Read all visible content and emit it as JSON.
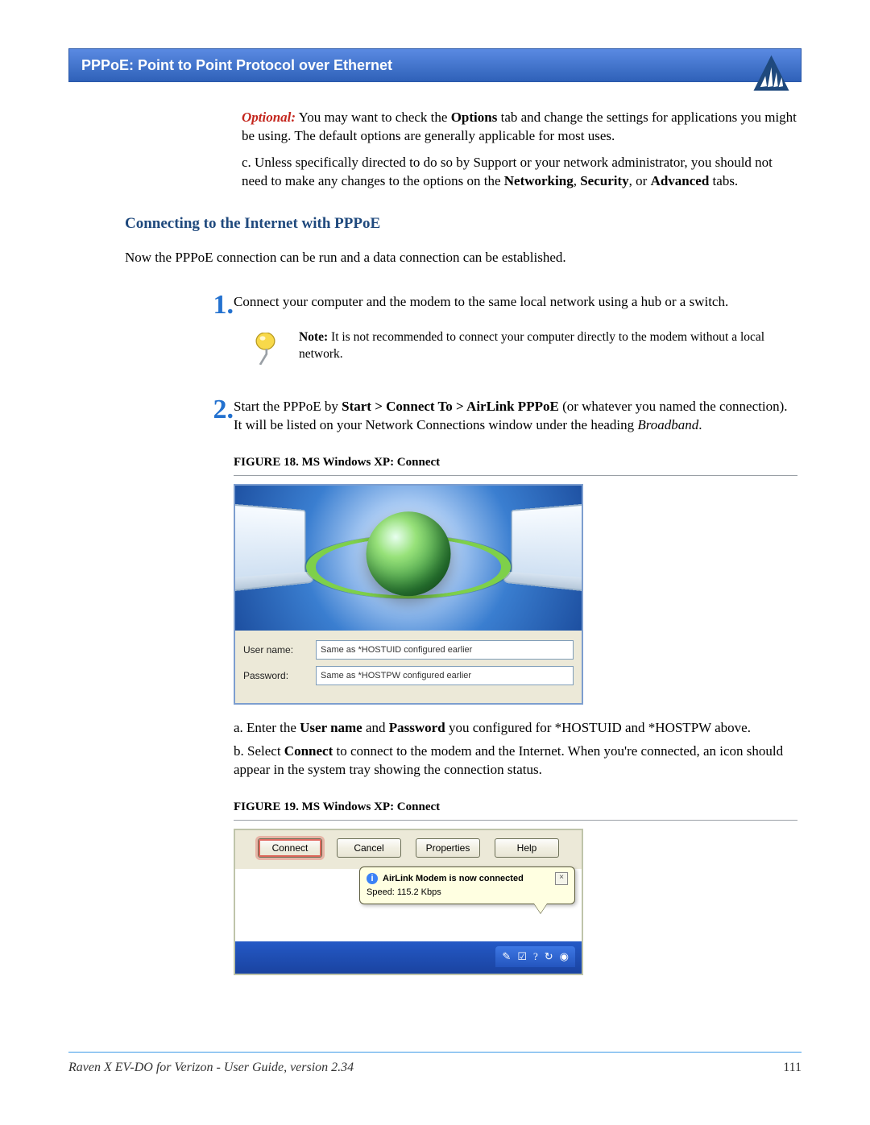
{
  "header": {
    "title": "PPPoE: Point to Point Protocol over Ethernet"
  },
  "intro": {
    "optional_label": "Optional:",
    "optional_text": " You may want to check the ",
    "options_bold": "Options",
    "optional_text2": " tab and change the settings for applications you might be using.  The default options are generally applicable for most uses.",
    "c_pre": "c. Unless specifically directed to do so by Support or your network administrator, you should not need to make any changes to the options on the ",
    "nw": "Networking",
    "comma": ", ",
    "sec": "Security",
    "or": ", or ",
    "adv": "Advanced",
    "c_post": " tabs."
  },
  "section_heading": "Connecting to the Internet with PPPoE",
  "section_intro": "Now the PPPoE connection can be run and a data connection can be established.",
  "step1": {
    "num": "1.",
    "text": "Connect your computer and the modem to the same local network using a hub or a switch.",
    "note_bold": "Note:",
    "note_text": " It is not recommended to connect your computer directly to the modem without a local network."
  },
  "step2": {
    "num": "2.",
    "pre": "Start the PPPoE by  ",
    "path": "Start >  Connect To > AirLink PPPoE",
    "post": " (or whatever you named the connection).  It will be listed on your Network Connections window under the heading ",
    "broadband": "Broadband",
    "dot": ".",
    "fig18": "FIGURE 18.  MS Windows XP: Connect",
    "user_label": "User name:",
    "user_value": "Same as *HOSTUID configured earlier",
    "pass_label": "Password:",
    "pass_value": "Same as *HOSTPW configured earlier",
    "a_pre": "a. Enter the ",
    "a_u": "User name",
    "a_and": " and ",
    "a_p": "Password",
    "a_post": " you configured for *HOSTUID and *HOSTPW above.",
    "b_pre": "b. Select ",
    "b_c": "Connect",
    "b_post": " to connect to the modem and the Internet. When you're connected, an icon should appear in the system tray showing the connection status.",
    "fig19": "FIGURE 19.  MS Windows XP: Connect",
    "btn_connect": "Connect",
    "btn_cancel": "Cancel",
    "btn_properties": "Properties",
    "btn_help": "Help",
    "balloon_title": "AirLink Modem is now connected",
    "balloon_speed": "Speed: 115.2 Kbps"
  },
  "footer": {
    "title": "Raven X EV-DO for Verizon - User Guide, version 2.34",
    "page": "111"
  },
  "icons": {
    "info": "i",
    "close": "×",
    "tray1": "✎",
    "tray2": "☑",
    "tray3": "?",
    "tray4": "↻",
    "tray5": "◉"
  }
}
